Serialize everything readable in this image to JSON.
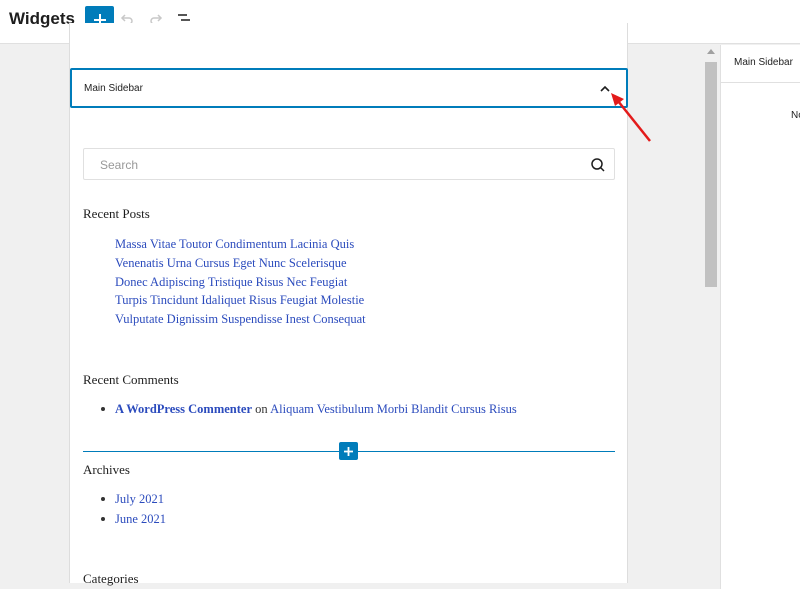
{
  "header": {
    "title": "Widgets",
    "add_icon": "plus-icon",
    "undo_icon": "undo-icon",
    "redo_icon": "redo-icon",
    "list_view_icon": "list-view-icon",
    "accent_color": "#007cba"
  },
  "widget_area": {
    "title": "Main Sidebar",
    "toggle_icon": "chevron-up-icon"
  },
  "search": {
    "placeholder": "Search",
    "icon": "search-icon"
  },
  "recent_posts": {
    "title": "Recent Posts",
    "items": [
      "Massa Vitae Toutor Condimentum Lacinia Quis",
      "Venenatis Urna Cursus Eget Nunc Scelerisque",
      "Donec Adipiscing Tristique Risus Nec Feugiat",
      "Turpis Tincidunt Idaliquet Risus Feugiat Molestie",
      "Vulputate Dignissim Suspendisse Inest Consequat"
    ]
  },
  "recent_comments": {
    "title": "Recent Comments",
    "items": [
      {
        "author": "A WordPress Commenter",
        "connector": "on",
        "post": "Aliquam Vestibulum Morbi Blandit Cursus Risus"
      }
    ]
  },
  "archives": {
    "title": "Archives",
    "items": [
      "July 2021",
      "June 2021"
    ]
  },
  "categories": {
    "title": "Categories"
  },
  "sidebar": {
    "tab_label": "Main Sidebar",
    "note": "No"
  }
}
